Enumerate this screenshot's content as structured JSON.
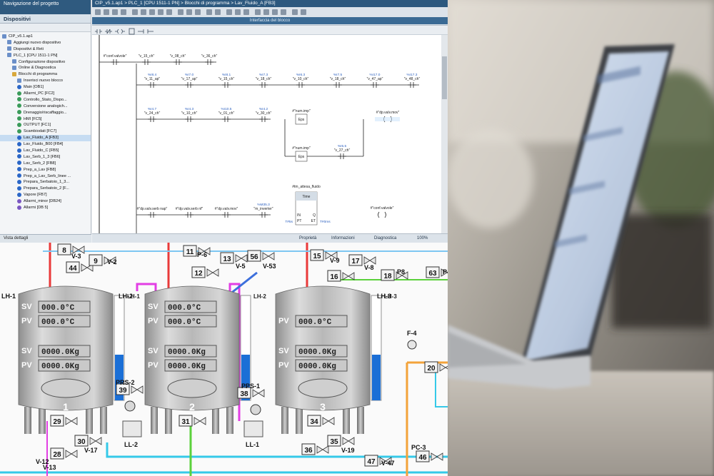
{
  "portal": {
    "window_title": "Navigazione del progetto",
    "tree_tab": "Dispositivi",
    "tree_items": [
      {
        "label": "CIP_v5.1.ap1",
        "icon": "project-icon",
        "level": 0
      },
      {
        "label": "Aggiungi nuovo dispositivo",
        "icon": "add-device-icon",
        "level": 1
      },
      {
        "label": "Dispositivi & Reti",
        "icon": "network-icon",
        "level": 1
      },
      {
        "label": "PLC_1 [CPU 1511-1 PN]",
        "icon": "plc-icon",
        "level": 1
      },
      {
        "label": "Configurazione dispositivo",
        "icon": "config-icon",
        "level": 2
      },
      {
        "label": "Online & Diagnostica",
        "icon": "diagnostics-icon",
        "level": 2
      },
      {
        "label": "Blocchi di programma",
        "icon": "folder-icon",
        "level": 2
      },
      {
        "label": "Inserisci nuovo blocco",
        "icon": "add-block-icon",
        "level": 3
      },
      {
        "label": "Main [OB1]",
        "icon": "ob-icon",
        "level": 3
      },
      {
        "label": "Allarmi_PC [FC2]",
        "icon": "fc-icon",
        "level": 3
      },
      {
        "label": "Controllo_Stato_Dispo...",
        "icon": "fc-icon",
        "level": 3
      },
      {
        "label": "Conversione analogich...",
        "icon": "fc-icon",
        "level": 3
      },
      {
        "label": "Drenaggio/riscaffaggio...",
        "icon": "fc-icon",
        "level": 3
      },
      {
        "label": "HMI [FC5]",
        "icon": "fc-icon",
        "level": 3
      },
      {
        "label": "OUTPUT [FC1]",
        "icon": "fc-icon",
        "level": 3
      },
      {
        "label": "Scambiodati [FC7]",
        "icon": "fc-icon",
        "level": 3
      },
      {
        "label": "Lav_Fluido_A [FB3]",
        "icon": "fb-icon",
        "level": 3,
        "selected": true
      },
      {
        "label": "Lav_Fluido_B00 [FB4]",
        "icon": "fb-icon",
        "level": 3
      },
      {
        "label": "Lav_Fluido_C [FB5]",
        "icon": "fb-icon",
        "level": 3
      },
      {
        "label": "Lav_Serb_1_3 [FB6]",
        "icon": "fb-icon",
        "level": 3
      },
      {
        "label": "Lav_Serb_2 [FB8]",
        "icon": "fb-icon",
        "level": 3
      },
      {
        "label": "Prep_a_Lav [FB8]",
        "icon": "fb-icon",
        "level": 3
      },
      {
        "label": "Prep_a_Lav_Serb_linee ...",
        "icon": "fb-icon",
        "level": 3
      },
      {
        "label": "Prepara_Serbatoio_1_3...",
        "icon": "fb-icon",
        "level": 3
      },
      {
        "label": "Prepara_Serbatoio_2 [F...",
        "icon": "fb-icon",
        "level": 3
      },
      {
        "label": "Vapore [FB7]",
        "icon": "fb-icon",
        "level": 3
      },
      {
        "label": "Allarmi_minor [DB24]",
        "icon": "db-icon",
        "level": 3
      },
      {
        "label": "Allarmi [DB 5]",
        "icon": "db-icon",
        "level": 3
      }
    ],
    "tree_footer": "Vista dettagli",
    "editor_title": "CIP_v5.1.ap1 > PLC_1 [CPU 1511-1 PN] > Blocchi di programma > Lav_Fluido_A [FB3]",
    "interface_label": "Interfaccia del blocco",
    "status_tabs": [
      "Proprietà",
      "Informazioni",
      "Diagnostica"
    ],
    "zoom": "100%"
  },
  "ladder": {
    "rungs": [
      {
        "contacts": [
          "#\"conf.valvole\"",
          "\"v_15_ch\"",
          "\"v_08_ch\"",
          "\"v_36_ch\""
        ]
      },
      {
        "contacts": [
          "%I8.4 \"v_11_ap\"",
          "%I7.0 \"v_17_ap\"",
          "%I8.1 \"v_15_ch\"",
          "%I7.3 \"v_18_ch\"",
          "%I6.3 \"v_10_ch\"",
          "%I7.5 \"v_18_ch\"",
          "%I17.0 \"v_47_ap\"",
          "%I17.3 \"v_48_ch\""
        ]
      },
      {
        "contacts": [
          "%I4.7 \"v_24_ch\"",
          "%I4.3 \"v_10_ch\"",
          "%I10.5 \"v_01_ch\"",
          "%I4.2 \"v_30_ch\""
        ],
        "branch_tops": [
          "#\"num.imp\"",
          "#\"num.imp\""
        ],
        "branch_box": "Eps",
        "branch_contacts": [
          "%I5.5 \"v_27_ch\""
        ],
        "coil": "#\"dp.valv.mov\""
      },
      {
        "contacts": [
          "#\"dp.valv.serb nap\"",
          "#\"dp.valv.serb nf\"",
          "#\"dp.valv.mov\"",
          "%M35.3 \"m_inverter\""
        ],
        "timer_title": "#tm_attesa_fluido",
        "timer_type": "Time",
        "timer_pins": [
          "IN",
          "PT",
          "Q",
          "ET"
        ],
        "timer_values": [
          "T#5s",
          "T#0ms"
        ],
        "coil": "#\"conf.valvole\""
      }
    ]
  },
  "scada": {
    "tanks": [
      {
        "number": "1",
        "rows": [
          {
            "tag": "SV",
            "value": "000.0°C"
          },
          {
            "tag": "PV",
            "value": "000.0°C"
          },
          {
            "tag": "SV",
            "value": "0000.0Kg"
          },
          {
            "tag": "PV",
            "value": "0000.0Kg"
          }
        ],
        "level_label": "LH-1"
      },
      {
        "number": "2",
        "rows": [
          {
            "tag": "SV",
            "value": "000.0°C"
          },
          {
            "tag": "PV",
            "value": "000.0°C"
          },
          {
            "tag": "SV",
            "value": "0000.0Kg"
          },
          {
            "tag": "PV",
            "value": "0000.0Kg"
          }
        ],
        "level_label": "LH-2"
      },
      {
        "number": "3",
        "rows": [
          {
            "tag": "PV",
            "value": "000.0°C"
          },
          {
            "tag": "SV",
            "value": "0000.0Kg"
          },
          {
            "tag": "PV",
            "value": "0000.0Kg"
          }
        ],
        "level_label": "LH-3"
      }
    ],
    "valve_badges": [
      "8",
      "44",
      "9",
      "11",
      "12",
      "13",
      "56",
      "15",
      "16",
      "17",
      "18",
      "63",
      "29",
      "30",
      "28",
      "31",
      "34",
      "35",
      "36",
      "20",
      "46",
      "47",
      "39",
      "38"
    ],
    "valve_labels": [
      "V-3",
      "V-2",
      "P-6",
      "V-5",
      "V-53",
      "V-9",
      "V-8",
      "P8",
      "P4",
      "V-17",
      "V-12",
      "V-19",
      "V-13",
      "V-47"
    ],
    "pump_labels": [
      "PRS-2",
      "PPS-1",
      "LL-2",
      "LL-1"
    ],
    "other_labels": [
      "F-4",
      "PC-3",
      "LH-1",
      "LH-2",
      "LH-3"
    ]
  },
  "photo": {
    "description_hidden": true
  },
  "colors": {
    "tank_body": "#b9b9b9",
    "pipe_red": "#e93a3a",
    "pipe_magenta": "#e23ee4",
    "pipe_blue": "#3d6fdc",
    "pipe_orange": "#f3a33a",
    "pipe_cyan": "#35c9e8",
    "pipe_green": "#5bd13b",
    "level_blue": "#1b6fd6",
    "display_bg": "#c9c9c9"
  }
}
